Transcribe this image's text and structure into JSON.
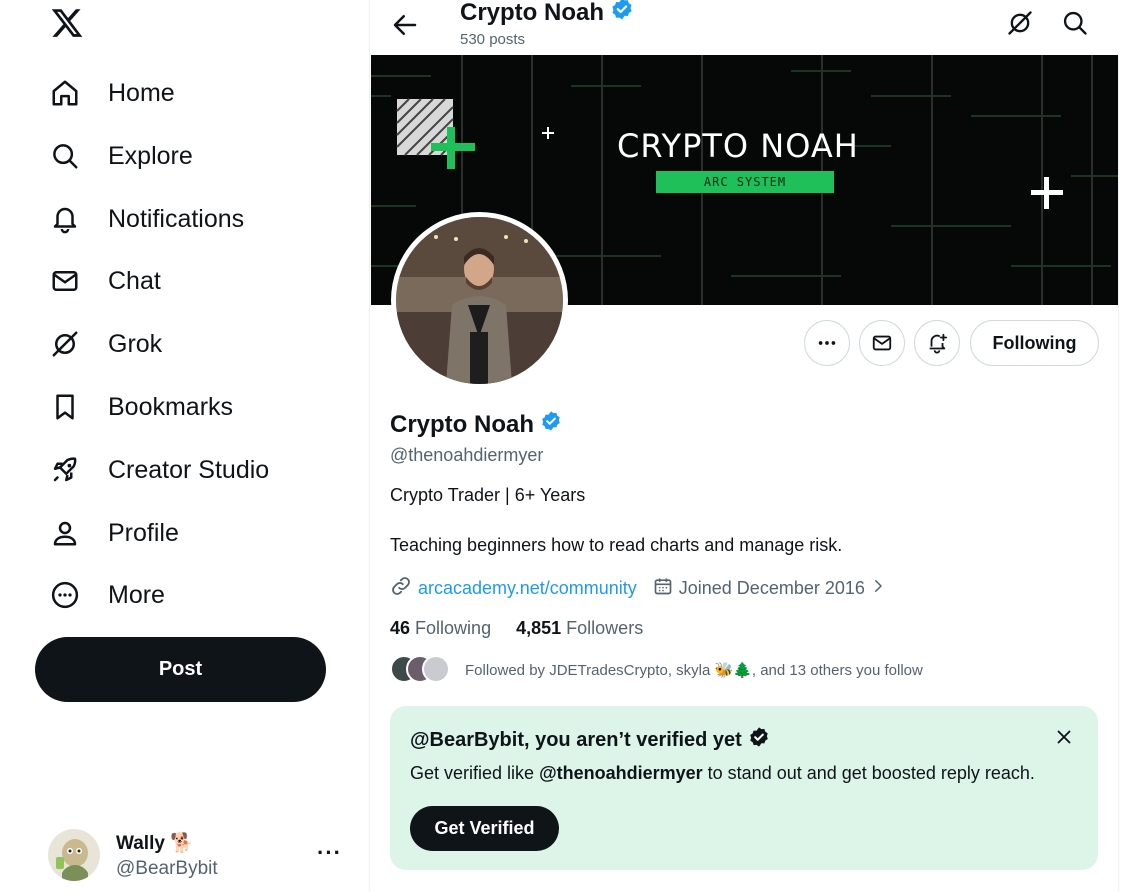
{
  "nav": {
    "items": [
      {
        "label": "Home",
        "icon": "home-icon"
      },
      {
        "label": "Explore",
        "icon": "search-icon"
      },
      {
        "label": "Notifications",
        "icon": "bell-icon"
      },
      {
        "label": "Chat",
        "icon": "envelope-icon"
      },
      {
        "label": "Grok",
        "icon": "grok-icon"
      },
      {
        "label": "Bookmarks",
        "icon": "bookmark-icon"
      },
      {
        "label": "Creator Studio",
        "icon": "rocket-icon"
      },
      {
        "label": "Profile",
        "icon": "person-icon"
      },
      {
        "label": "More",
        "icon": "more-circle-icon"
      }
    ],
    "post_label": "Post"
  },
  "account": {
    "name": "Wally 🐕",
    "handle": "@BearBybit",
    "more": "···"
  },
  "header": {
    "name": "Crypto Noah",
    "posts": "530 posts"
  },
  "banner": {
    "title": "CRYPTO NOAH",
    "subtitle": "ARC SYSTEM",
    "accent": "#1fbf5a"
  },
  "profile": {
    "name": "Crypto Noah",
    "handle": "@thenoahdiermyer",
    "bio_line1": "Crypto Trader | 6+ Years",
    "bio_line2": "Teaching beginners how to read charts and manage risk.",
    "link": "arcacademy.net/community",
    "joined": "Joined December 2016",
    "following_count": "46",
    "following_label": "Following",
    "followers_count": "4,851",
    "followers_label": "Followers",
    "followed_by": "Followed by JDETradesCrypto, skyla 🐝🌲, and 13 others you follow",
    "follow_button": "Following"
  },
  "verify": {
    "title": "@BearBybit, you aren’t verified yet",
    "desc_prefix": "Get verified like ",
    "desc_handle": "@thenoahdiermyer",
    "desc_suffix": " to stand out and get boosted reply reach.",
    "button": "Get Verified"
  },
  "colors": {
    "link": "#1d9bf0",
    "verified": "#1d9bf0",
    "muted": "#536471",
    "card_bg": "#dcf5e8"
  }
}
